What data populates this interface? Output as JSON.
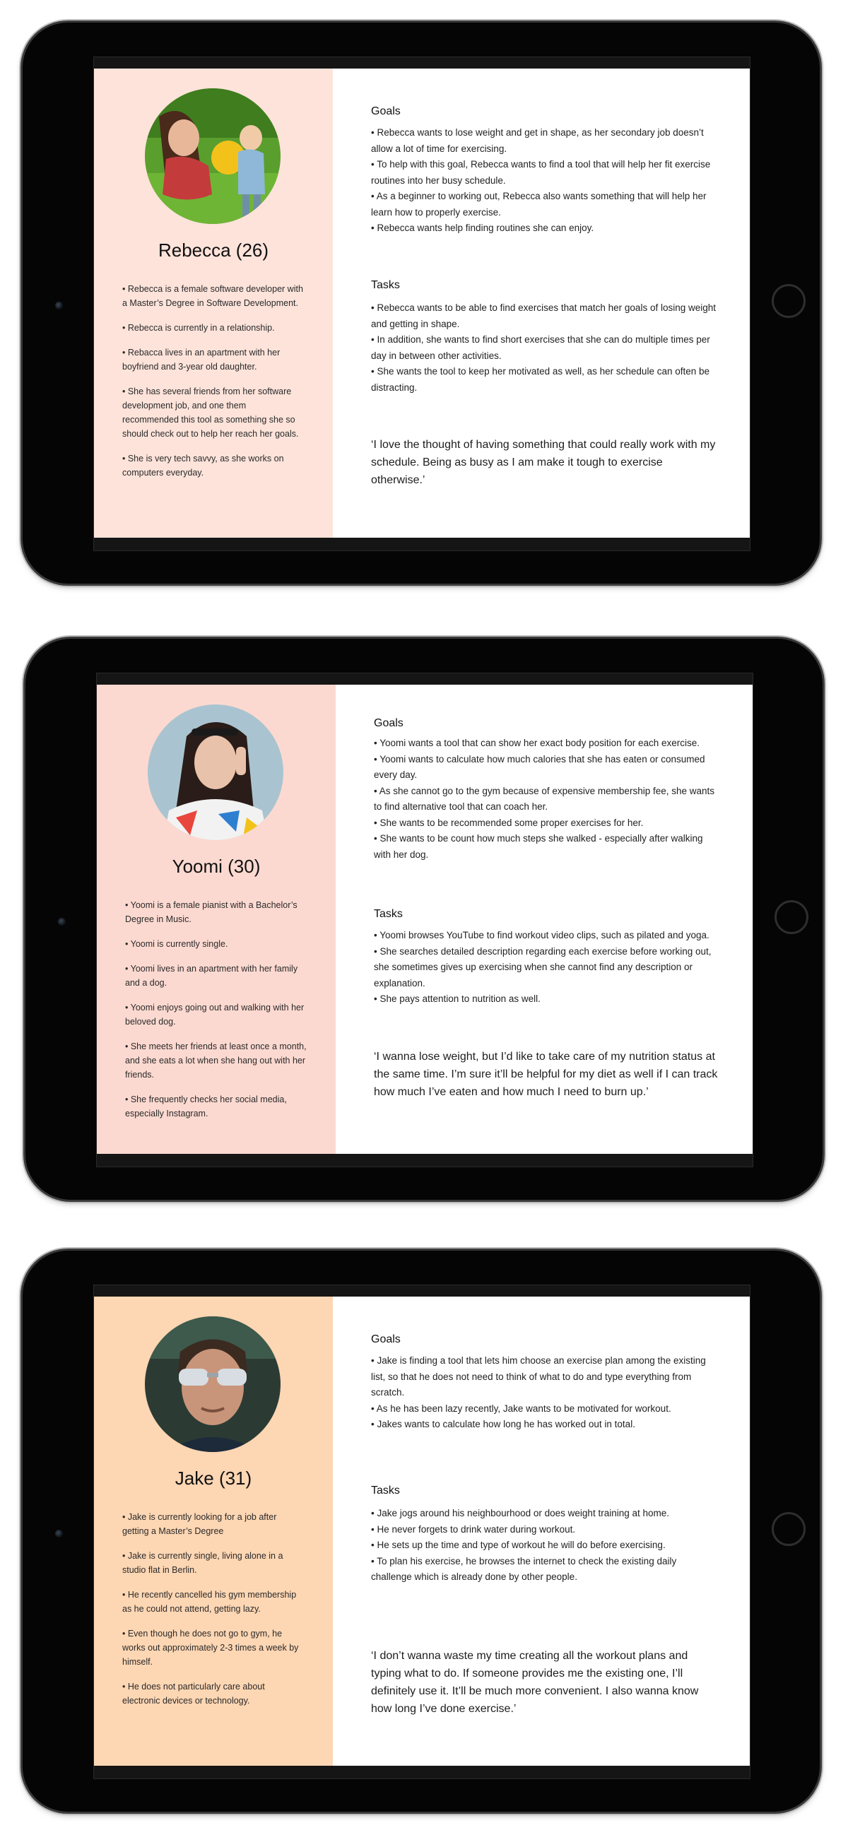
{
  "personas": [
    {
      "name": "Rebecca (26)",
      "panel_color": "#fde3da",
      "bio": [
        "• Rebecca is a female software developer with a Master’s Degree in Software Development.",
        "• Rebecca is currently in a relationship.",
        "• Rebacca lives in an apartment with her boyfriend and 3-year old daughter.",
        "• She has several friends from her software development job, and one them recommended this tool as something she so should check out to help her reach her goals.",
        "• She is very tech savvy, as she works on computers everyday."
      ],
      "goals_heading": "Goals",
      "goals": [
        "• Rebecca wants to lose weight and get in shape, as her secondary job doesn’t allow a lot of time for exercising.",
        "• To help with this goal, Rebecca wants to find a tool that will help her fit exercise routines into her busy schedule.",
        "• As a beginner to working out, Rebecca also wants something that will help her learn how to properly exercise.",
        "• Rebecca wants help finding routines she can enjoy."
      ],
      "tasks_heading": "Tasks",
      "tasks": [
        "• Rebecca wants to be able to find exercises that match her goals of losing weight and getting in shape.",
        "• In addition, she wants to find short exercises that she can do multiple times per day in between other activities.",
        "• She wants the tool to keep her motivated as well, as her schedule can often be distracting."
      ],
      "quote": "‘I love the thought of having something that could really work with my schedule. Being as busy as I am make it tough to exercise otherwise.’"
    },
    {
      "name": "Yoomi (30)",
      "panel_color": "#fcd9d0",
      "bio": [
        "• Yoomi is a female pianist with a Bachelor’s Degree in Music.",
        "• Yoomi is currently single.",
        "• Yoomi lives in an apartment with her family and a dog.",
        "• Yoomi enjoys going out and walking with her beloved dog.",
        "• She meets her friends at least once a month, and she eats a lot when she hang out with her friends.",
        "• She frequently checks her social media, especially Instagram."
      ],
      "goals_heading": "Goals",
      "goals": [
        "• Yoomi wants a tool that can show her exact body position for each exercise.",
        "• Yoomi wants to calculate how much calories that she has eaten or consumed every day.",
        "• As she cannot go to the gym because of expensive membership fee, she wants to find alternative tool that can coach her.",
        "• She wants to be recommended some proper exercises for her.",
        "• She wants to be count how much steps she walked - especially after walking with her dog."
      ],
      "tasks_heading": "Tasks",
      "tasks": [
        "• Yoomi browses YouTube to find workout video clips, such as pilated and yoga.",
        "• She searches detailed description regarding each exercise before working out, she sometimes gives up exercising when she cannot find any description or explanation.",
        "• She pays attention to nutrition as well."
      ],
      "quote": "‘I wanna lose weight, but I’d like to take care of my nutrition status at the same time. I’m sure it’ll be helpful for my diet as well if I can track how much I’ve eaten and how much I need to burn up.’"
    },
    {
      "name": "Jake (31)",
      "panel_color": "#fdd6b3",
      "bio": [
        "• Jake is currently looking for a job after getting a Master’s Degree",
        "• Jake is currently single, living alone in a studio flat in Berlin.",
        "• He recently cancelled his gym membership as he could not attend, getting lazy.",
        "• Even though he does not go to gym, he works out approximately 2-3 times a week by himself.",
        "• He does not particularly care about electronic devices or technology."
      ],
      "goals_heading": "Goals",
      "goals": [
        "• Jake is finding a tool that lets him choose an exercise plan among the existing list, so that he does not need to think of what to do and type everything from scratch.",
        "• As he has been lazy recently, Jake wants to be motivated for workout.",
        "• Jakes wants to calculate how long he has worked out in total."
      ],
      "tasks_heading": "Tasks",
      "tasks": [
        "• Jake jogs around his neighbourhood or does weight training at home.",
        "• He never forgets to drink water during workout.",
        "• He sets up the time and type of workout he will do before exercising.",
        "• To plan his exercise, he browses the internet to check the existing daily challenge which is already done by other people."
      ],
      "quote": "‘I don’t wanna waste my time creating all the workout plans and typing what to do. If someone provides me the existing one, I’ll definitely use it. It’ll be much more convenient. I also wanna know how long I’ve done exercise.’"
    }
  ]
}
